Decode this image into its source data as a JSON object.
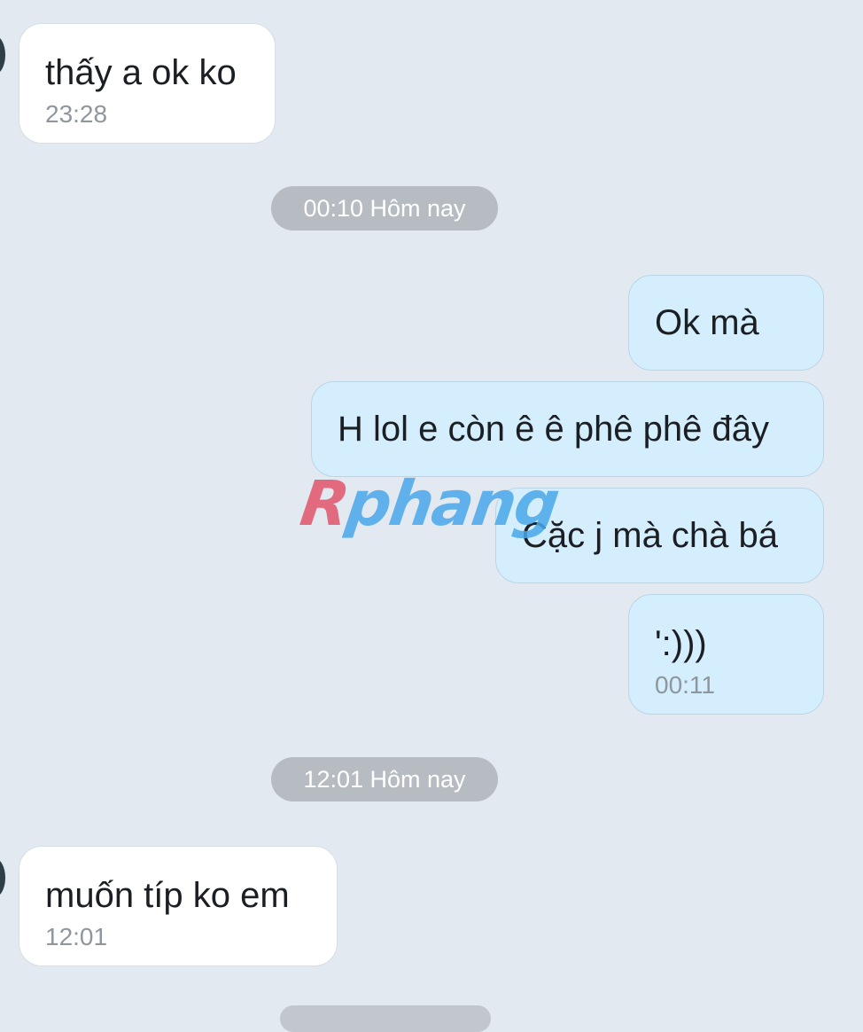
{
  "messages": [
    {
      "direction": "incoming",
      "text": "thấy a ok ko",
      "time": "23:28"
    },
    {
      "direction": "outgoing",
      "text": "Ok mà"
    },
    {
      "direction": "outgoing",
      "text": "H lol e còn ê ê phê phê đây"
    },
    {
      "direction": "outgoing",
      "text": "Cặc j mà chà bá"
    },
    {
      "direction": "outgoing",
      "text": "':)))",
      "time": "00:11"
    },
    {
      "direction": "incoming",
      "text": "muốn típ ko em",
      "time": "12:01"
    }
  ],
  "date_separators": [
    "00:10 Hôm nay",
    "12:01 Hôm nay"
  ],
  "watermark": {
    "first_letter": "R",
    "rest": "phang"
  },
  "colors": {
    "background": "#e2e9f1",
    "incoming_bubble": "#ffffff",
    "outgoing_bubble": "#d4eefd",
    "separator_pill": "#b6bcc1",
    "timestamp": "#8f979e"
  }
}
